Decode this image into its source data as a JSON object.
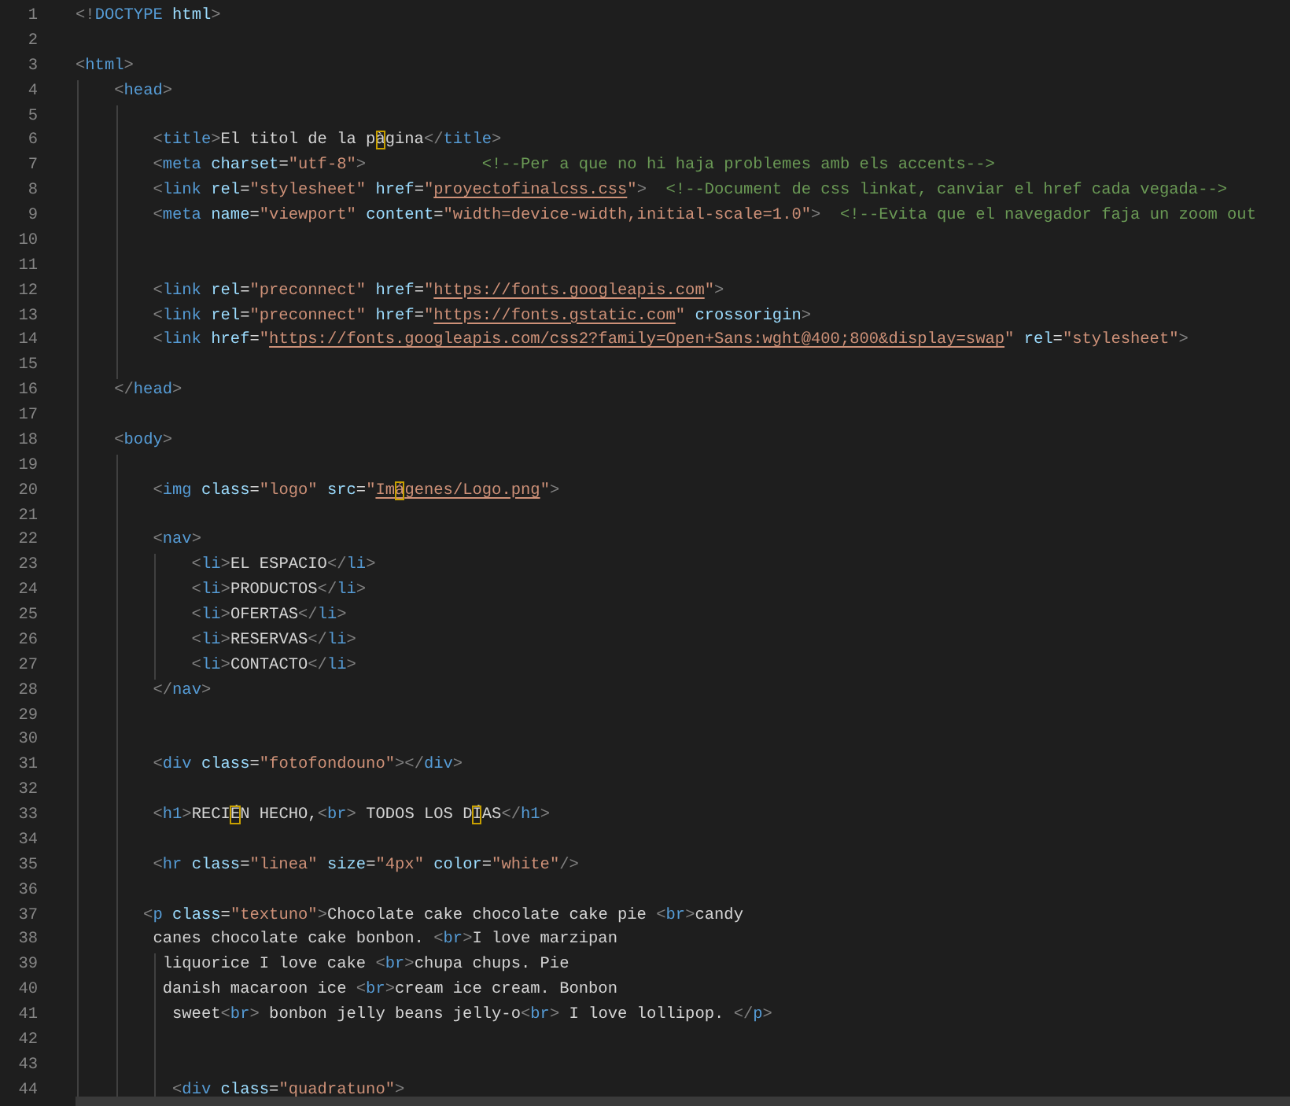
{
  "editor": {
    "lines": [
      {
        "n": "1",
        "tokens": [
          {
            "kind": "punct",
            "text": "<!"
          },
          {
            "kind": "tag",
            "text": "DOCTYPE "
          },
          {
            "kind": "attr",
            "text": "html"
          },
          {
            "kind": "punct",
            "text": ">"
          }
        ]
      },
      {
        "n": "2"
      },
      {
        "n": "3",
        "tokens": [
          {
            "kind": "punct",
            "text": "<"
          },
          {
            "kind": "tag",
            "text": "html"
          },
          {
            "kind": "punct",
            "text": ">"
          }
        ]
      },
      {
        "n": "4",
        "tokens": [
          {
            "kind": "punct",
            "text": "    <"
          },
          {
            "kind": "tag",
            "text": "head"
          },
          {
            "kind": "punct",
            "text": ">"
          }
        ]
      },
      {
        "n": "5"
      },
      {
        "n": "6",
        "tokens": [
          {
            "kind": "punct",
            "text": "        <"
          },
          {
            "kind": "tag",
            "text": "title"
          },
          {
            "kind": "punct",
            "text": ">"
          },
          {
            "kind": "text",
            "text": "El titol de la p"
          },
          {
            "kind": "mark",
            "text": "à"
          },
          {
            "kind": "text",
            "text": "gina"
          },
          {
            "kind": "punct",
            "text": "</"
          },
          {
            "kind": "tag",
            "text": "title"
          },
          {
            "kind": "punct",
            "text": ">"
          }
        ]
      },
      {
        "n": "7",
        "tokens": [
          {
            "kind": "punct",
            "text": "        <"
          },
          {
            "kind": "tag",
            "text": "meta "
          },
          {
            "kind": "attr",
            "text": "charset"
          },
          {
            "kind": "text",
            "text": "="
          },
          {
            "kind": "str",
            "text": "\"utf-8\""
          },
          {
            "kind": "punct",
            "text": ">"
          },
          {
            "kind": "comment",
            "text": "            <!--Per a que no hi haja problemes amb els accents-->"
          }
        ]
      },
      {
        "n": "8",
        "tokens": [
          {
            "kind": "punct",
            "text": "        <"
          },
          {
            "kind": "tag",
            "text": "link "
          },
          {
            "kind": "attr",
            "text": "rel"
          },
          {
            "kind": "text",
            "text": "="
          },
          {
            "kind": "str",
            "text": "\"stylesheet\" "
          },
          {
            "kind": "attr",
            "text": "href"
          },
          {
            "kind": "text",
            "text": "="
          },
          {
            "kind": "str",
            "text": "\""
          },
          {
            "kind": "link",
            "text": "proyectofinalcss.css"
          },
          {
            "kind": "str",
            "text": "\""
          },
          {
            "kind": "punct",
            "text": ">"
          },
          {
            "kind": "comment",
            "text": "  <!--Document de css linkat, canviar el href cada vegada-->"
          }
        ]
      },
      {
        "n": "9",
        "tokens": [
          {
            "kind": "punct",
            "text": "        <"
          },
          {
            "kind": "tag",
            "text": "meta "
          },
          {
            "kind": "attr",
            "text": "name"
          },
          {
            "kind": "text",
            "text": "="
          },
          {
            "kind": "str",
            "text": "\"viewport\" "
          },
          {
            "kind": "attr",
            "text": "content"
          },
          {
            "kind": "text",
            "text": "="
          },
          {
            "kind": "str",
            "text": "\"width=device-width,initial-scale=1.0\""
          },
          {
            "kind": "punct",
            "text": ">"
          },
          {
            "kind": "comment",
            "text": "  <!--Evita que el navegador faja un zoom out"
          }
        ]
      },
      {
        "n": "10"
      },
      {
        "n": "11"
      },
      {
        "n": "12",
        "tokens": [
          {
            "kind": "punct",
            "text": "        <"
          },
          {
            "kind": "tag",
            "text": "link "
          },
          {
            "kind": "attr",
            "text": "rel"
          },
          {
            "kind": "text",
            "text": "="
          },
          {
            "kind": "str",
            "text": "\"preconnect\" "
          },
          {
            "kind": "attr",
            "text": "href"
          },
          {
            "kind": "text",
            "text": "="
          },
          {
            "kind": "str",
            "text": "\""
          },
          {
            "kind": "link",
            "text": "https://fonts.googleapis.com"
          },
          {
            "kind": "str",
            "text": "\""
          },
          {
            "kind": "punct",
            "text": ">"
          }
        ]
      },
      {
        "n": "13",
        "tokens": [
          {
            "kind": "punct",
            "text": "        <"
          },
          {
            "kind": "tag",
            "text": "link "
          },
          {
            "kind": "attr",
            "text": "rel"
          },
          {
            "kind": "text",
            "text": "="
          },
          {
            "kind": "str",
            "text": "\"preconnect\" "
          },
          {
            "kind": "attr",
            "text": "href"
          },
          {
            "kind": "text",
            "text": "="
          },
          {
            "kind": "str",
            "text": "\""
          },
          {
            "kind": "link",
            "text": "https://fonts.gstatic.com"
          },
          {
            "kind": "str",
            "text": "\" "
          },
          {
            "kind": "attr",
            "text": "crossorigin"
          },
          {
            "kind": "punct",
            "text": ">"
          }
        ]
      },
      {
        "n": "14",
        "tokens": [
          {
            "kind": "punct",
            "text": "        <"
          },
          {
            "kind": "tag",
            "text": "link "
          },
          {
            "kind": "attr",
            "text": "href"
          },
          {
            "kind": "text",
            "text": "="
          },
          {
            "kind": "str",
            "text": "\""
          },
          {
            "kind": "link",
            "text": "https://fonts.googleapis.com/css2?family=Open+Sans:wght@400;800&display=swap"
          },
          {
            "kind": "str",
            "text": "\" "
          },
          {
            "kind": "attr",
            "text": "rel"
          },
          {
            "kind": "text",
            "text": "="
          },
          {
            "kind": "str",
            "text": "\"stylesheet\""
          },
          {
            "kind": "punct",
            "text": ">"
          }
        ]
      },
      {
        "n": "15"
      },
      {
        "n": "16",
        "tokens": [
          {
            "kind": "punct",
            "text": "    </"
          },
          {
            "kind": "tag",
            "text": "head"
          },
          {
            "kind": "punct",
            "text": ">"
          }
        ]
      },
      {
        "n": "17"
      },
      {
        "n": "18",
        "tokens": [
          {
            "kind": "punct",
            "text": "    <"
          },
          {
            "kind": "tag",
            "text": "body"
          },
          {
            "kind": "punct",
            "text": ">"
          }
        ]
      },
      {
        "n": "19"
      },
      {
        "n": "20",
        "tokens": [
          {
            "kind": "punct",
            "text": "        <"
          },
          {
            "kind": "tag",
            "text": "img "
          },
          {
            "kind": "attr",
            "text": "class"
          },
          {
            "kind": "text",
            "text": "="
          },
          {
            "kind": "str",
            "text": "\"logo\" "
          },
          {
            "kind": "attr",
            "text": "src"
          },
          {
            "kind": "text",
            "text": "="
          },
          {
            "kind": "str",
            "text": "\""
          },
          {
            "kind": "link",
            "text": "Im"
          },
          {
            "kind": "linkmark",
            "text": "á"
          },
          {
            "kind": "link",
            "text": "genes/Logo.png"
          },
          {
            "kind": "str",
            "text": "\""
          },
          {
            "kind": "punct",
            "text": ">"
          }
        ]
      },
      {
        "n": "21"
      },
      {
        "n": "22",
        "tokens": [
          {
            "kind": "punct",
            "text": "        <"
          },
          {
            "kind": "tag",
            "text": "nav"
          },
          {
            "kind": "punct",
            "text": ">"
          }
        ]
      },
      {
        "n": "23",
        "tokens": [
          {
            "kind": "punct",
            "text": "            <"
          },
          {
            "kind": "tag",
            "text": "li"
          },
          {
            "kind": "punct",
            "text": ">"
          },
          {
            "kind": "text",
            "text": "EL ESPACIO"
          },
          {
            "kind": "punct",
            "text": "</"
          },
          {
            "kind": "tag",
            "text": "li"
          },
          {
            "kind": "punct",
            "text": ">"
          }
        ]
      },
      {
        "n": "24",
        "tokens": [
          {
            "kind": "punct",
            "text": "            <"
          },
          {
            "kind": "tag",
            "text": "li"
          },
          {
            "kind": "punct",
            "text": ">"
          },
          {
            "kind": "text",
            "text": "PRODUCTOS"
          },
          {
            "kind": "punct",
            "text": "</"
          },
          {
            "kind": "tag",
            "text": "li"
          },
          {
            "kind": "punct",
            "text": ">"
          }
        ]
      },
      {
        "n": "25",
        "tokens": [
          {
            "kind": "punct",
            "text": "            <"
          },
          {
            "kind": "tag",
            "text": "li"
          },
          {
            "kind": "punct",
            "text": ">"
          },
          {
            "kind": "text",
            "text": "OFERTAS"
          },
          {
            "kind": "punct",
            "text": "</"
          },
          {
            "kind": "tag",
            "text": "li"
          },
          {
            "kind": "punct",
            "text": ">"
          }
        ]
      },
      {
        "n": "26",
        "tokens": [
          {
            "kind": "punct",
            "text": "            <"
          },
          {
            "kind": "tag",
            "text": "li"
          },
          {
            "kind": "punct",
            "text": ">"
          },
          {
            "kind": "text",
            "text": "RESERVAS"
          },
          {
            "kind": "punct",
            "text": "</"
          },
          {
            "kind": "tag",
            "text": "li"
          },
          {
            "kind": "punct",
            "text": ">"
          }
        ]
      },
      {
        "n": "27",
        "tokens": [
          {
            "kind": "punct",
            "text": "            <"
          },
          {
            "kind": "tag",
            "text": "li"
          },
          {
            "kind": "punct",
            "text": ">"
          },
          {
            "kind": "text",
            "text": "CONTACTO"
          },
          {
            "kind": "punct",
            "text": "</"
          },
          {
            "kind": "tag",
            "text": "li"
          },
          {
            "kind": "punct",
            "text": ">"
          }
        ]
      },
      {
        "n": "28",
        "tokens": [
          {
            "kind": "punct",
            "text": "        </"
          },
          {
            "kind": "tag",
            "text": "nav"
          },
          {
            "kind": "punct",
            "text": ">"
          }
        ]
      },
      {
        "n": "29"
      },
      {
        "n": "30"
      },
      {
        "n": "31",
        "tokens": [
          {
            "kind": "punct",
            "text": "        <"
          },
          {
            "kind": "tag",
            "text": "div "
          },
          {
            "kind": "attr",
            "text": "class"
          },
          {
            "kind": "text",
            "text": "="
          },
          {
            "kind": "str",
            "text": "\"fotofondouno\""
          },
          {
            "kind": "punct",
            "text": "></"
          },
          {
            "kind": "tag",
            "text": "div"
          },
          {
            "kind": "punct",
            "text": ">"
          }
        ]
      },
      {
        "n": "32"
      },
      {
        "n": "33",
        "tokens": [
          {
            "kind": "punct",
            "text": "        <"
          },
          {
            "kind": "tag",
            "text": "h1"
          },
          {
            "kind": "punct",
            "text": ">"
          },
          {
            "kind": "text",
            "text": "RECI"
          },
          {
            "kind": "mark",
            "text": "É"
          },
          {
            "kind": "text",
            "text": "N HECHO,"
          },
          {
            "kind": "punct",
            "text": "<"
          },
          {
            "kind": "tag",
            "text": "br"
          },
          {
            "kind": "punct",
            "text": ">"
          },
          {
            "kind": "text",
            "text": " TODOS LOS D"
          },
          {
            "kind": "mark",
            "text": "Í"
          },
          {
            "kind": "text",
            "text": "AS"
          },
          {
            "kind": "punct",
            "text": "</"
          },
          {
            "kind": "tag",
            "text": "h1"
          },
          {
            "kind": "punct",
            "text": ">"
          }
        ]
      },
      {
        "n": "34"
      },
      {
        "n": "35",
        "tokens": [
          {
            "kind": "punct",
            "text": "        <"
          },
          {
            "kind": "tag",
            "text": "hr "
          },
          {
            "kind": "attr",
            "text": "class"
          },
          {
            "kind": "text",
            "text": "="
          },
          {
            "kind": "str",
            "text": "\"linea\" "
          },
          {
            "kind": "attr",
            "text": "size"
          },
          {
            "kind": "text",
            "text": "="
          },
          {
            "kind": "str",
            "text": "\"4px\" "
          },
          {
            "kind": "attr",
            "text": "color"
          },
          {
            "kind": "text",
            "text": "="
          },
          {
            "kind": "str",
            "text": "\"white\""
          },
          {
            "kind": "punct",
            "text": "/>"
          }
        ]
      },
      {
        "n": "36"
      },
      {
        "n": "37",
        "tokens": [
          {
            "kind": "punct",
            "text": "       <"
          },
          {
            "kind": "tag",
            "text": "p "
          },
          {
            "kind": "attr",
            "text": "class"
          },
          {
            "kind": "text",
            "text": "="
          },
          {
            "kind": "str",
            "text": "\"textuno\""
          },
          {
            "kind": "punct",
            "text": ">"
          },
          {
            "kind": "text",
            "text": "Chocolate cake chocolate cake pie "
          },
          {
            "kind": "punct",
            "text": "<"
          },
          {
            "kind": "tag",
            "text": "br"
          },
          {
            "kind": "punct",
            "text": ">"
          },
          {
            "kind": "text",
            "text": "candy"
          }
        ]
      },
      {
        "n": "38",
        "tokens": [
          {
            "kind": "text",
            "text": "        canes chocolate cake bonbon. "
          },
          {
            "kind": "punct",
            "text": "<"
          },
          {
            "kind": "tag",
            "text": "br"
          },
          {
            "kind": "punct",
            "text": ">"
          },
          {
            "kind": "text",
            "text": "I love marzipan"
          }
        ]
      },
      {
        "n": "39",
        "tokens": [
          {
            "kind": "text",
            "text": "         liquorice I love cake "
          },
          {
            "kind": "punct",
            "text": "<"
          },
          {
            "kind": "tag",
            "text": "br"
          },
          {
            "kind": "punct",
            "text": ">"
          },
          {
            "kind": "text",
            "text": "chupa chups. Pie"
          }
        ]
      },
      {
        "n": "40",
        "tokens": [
          {
            "kind": "text",
            "text": "         danish macaroon ice "
          },
          {
            "kind": "punct",
            "text": "<"
          },
          {
            "kind": "tag",
            "text": "br"
          },
          {
            "kind": "punct",
            "text": ">"
          },
          {
            "kind": "text",
            "text": "cream ice cream. Bonbon"
          }
        ]
      },
      {
        "n": "41",
        "tokens": [
          {
            "kind": "text",
            "text": "          sweet"
          },
          {
            "kind": "punct",
            "text": "<"
          },
          {
            "kind": "tag",
            "text": "br"
          },
          {
            "kind": "punct",
            "text": ">"
          },
          {
            "kind": "text",
            "text": " bonbon jelly beans jelly-o"
          },
          {
            "kind": "punct",
            "text": "<"
          },
          {
            "kind": "tag",
            "text": "br"
          },
          {
            "kind": "punct",
            "text": ">"
          },
          {
            "kind": "text",
            "text": " I love lollipop. "
          },
          {
            "kind": "punct",
            "text": "</"
          },
          {
            "kind": "tag",
            "text": "p"
          },
          {
            "kind": "punct",
            "text": ">"
          }
        ]
      },
      {
        "n": "42"
      },
      {
        "n": "43"
      },
      {
        "n": "44",
        "tokens": [
          {
            "kind": "punct",
            "text": "          <"
          },
          {
            "kind": "tag",
            "text": "div "
          },
          {
            "kind": "attr",
            "text": "class"
          },
          {
            "kind": "text",
            "text": "="
          },
          {
            "kind": "str",
            "text": "\"quadratuno\""
          },
          {
            "kind": "punct",
            "text": ">"
          }
        ]
      }
    ]
  }
}
